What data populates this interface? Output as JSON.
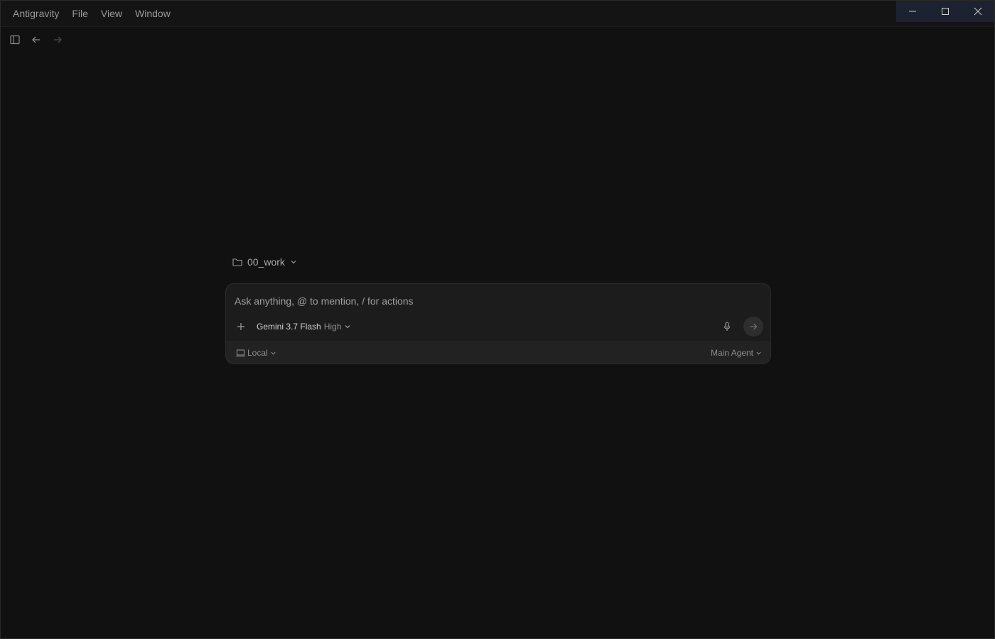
{
  "menu": {
    "app_name": "Antigravity",
    "items": [
      {
        "label": "File"
      },
      {
        "label": "View"
      },
      {
        "label": "Window"
      }
    ]
  },
  "window_controls": {
    "icons": [
      "minimize-icon",
      "maximize-icon",
      "close-icon"
    ]
  },
  "toolbar": {
    "icons": [
      "sidebar-toggle-icon",
      "arrow-left-icon",
      "arrow-right-icon"
    ]
  },
  "workspace": {
    "name": "00_work",
    "icon": "folder-icon"
  },
  "chat": {
    "placeholder": "Ask anything, @ to mention, / for actions",
    "value": "",
    "model": "Gemini 3.7 Flash",
    "model_level": "High",
    "environment": "Local",
    "agent": "Main Agent"
  },
  "colors": {
    "background": "#111111",
    "card": "#1c1c1c",
    "card_footer": "#222222",
    "window_controls_bg": "#1c2230",
    "text_primary": "#d0d0d0",
    "text_muted": "#8c8c8c"
  }
}
